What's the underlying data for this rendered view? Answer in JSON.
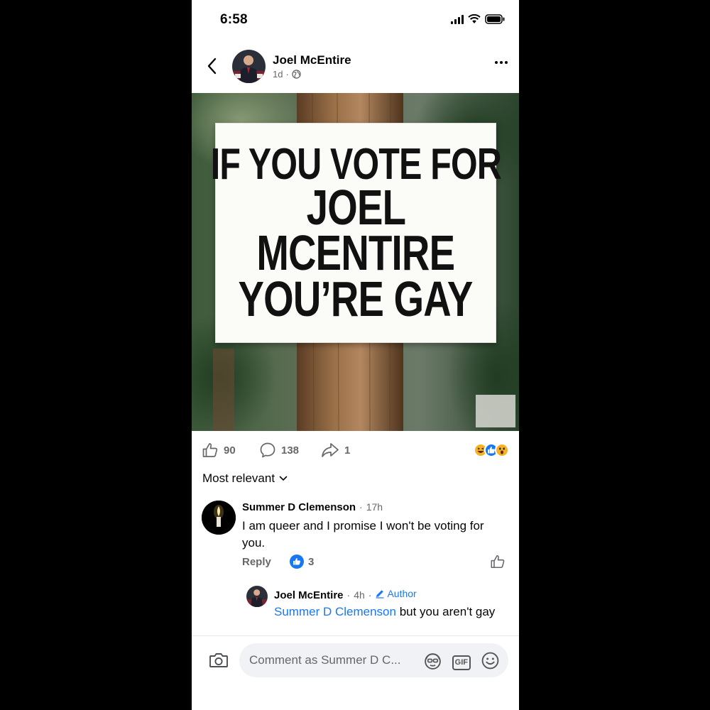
{
  "status_bar": {
    "time": "6:58"
  },
  "post": {
    "author": "Joel McEntire",
    "time": "1d",
    "meta_separator": "·",
    "sign_lines": [
      "IF YOU VOTE FOR",
      "JOEL",
      "MCENTIRE",
      "YOU’RE GAY"
    ]
  },
  "stats": {
    "likes": "90",
    "comments": "138",
    "shares": "1"
  },
  "sort_label": "Most relevant",
  "comments": [
    {
      "author": "Summer D Clemenson",
      "time": "17h",
      "text": "I am queer and I promise I won't be voting for you.",
      "reply_label": "Reply",
      "likes": "3"
    }
  ],
  "reply": {
    "author": "Joel McEntire",
    "time": "4h",
    "badge": "Author",
    "mention": "Summer D Clemenson",
    "text": "but you aren't gay"
  },
  "composer": {
    "placeholder": "Comment as Summer D C...",
    "gif_label": "GIF"
  },
  "colors": {
    "accent": "#1877f2",
    "muted": "#65676b",
    "background": "#ffffff",
    "frame": "#000000"
  }
}
